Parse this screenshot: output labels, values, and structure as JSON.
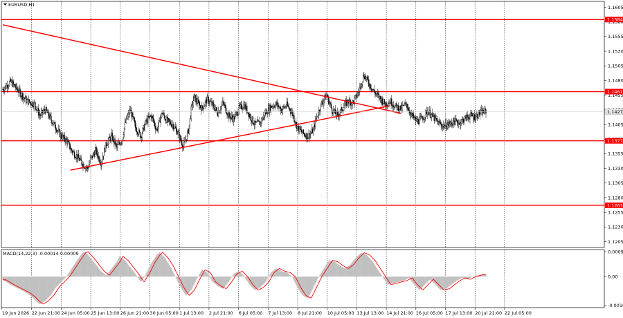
{
  "symbol_title": "EURUSD,H1",
  "colors": {
    "level": "#ff0000",
    "candle": "#000000",
    "macd_hist": "#c0c0c0",
    "signal": "#ff0000",
    "price_tag_bg": "#e6e6e6"
  },
  "chart_data": {
    "type": "candlestick",
    "price_axis": {
      "ticks": [
        "1.1605",
        "1.1580",
        "1.1555",
        "1.1530",
        "1.1505",
        "1.1480",
        "1.1455",
        "1.1430",
        "1.1405",
        "1.1380",
        "1.1355",
        "1.1330",
        "1.1305",
        "1.1280",
        "1.1255",
        "1.1230",
        "1.1205"
      ],
      "range": [
        1.1195,
        1.1615
      ]
    },
    "current_price": "1.1427",
    "horizontal_levels": [
      {
        "label": "1.1584",
        "value": 1.1584
      },
      {
        "label": "1.1461",
        "value": 1.1461
      },
      {
        "label": "1.1377",
        "value": 1.1377
      },
      {
        "label": "1.1267",
        "value": 1.1267
      }
    ],
    "trend_lines": [
      {
        "from": [
          "18 Jun 2026 21:00",
          1.1575
        ],
        "to": [
          "15 Jul 2026 13:00",
          1.1424
        ]
      },
      {
        "from": [
          "24 Jun 2026 05:00",
          1.1327
        ],
        "to": [
          "15 Jul 2026 00:00",
          1.1437
        ]
      }
    ],
    "time_labels": [
      "19 Jun 2026",
      "22 Jun 21:00",
      "24 Jun 05:00",
      "25 Jun 13:00",
      "26 Jun 21:00",
      "30 Jun 05:00",
      "1 Jul 13:00",
      "2 Jul 21:00",
      "6 Jul 05:00",
      "7 Jul 13:00",
      "8 Jul 21:00",
      "10 Jul 05:00",
      "13 Jul 13:00",
      "14 Jul 21:00",
      "16 Jul 05:00",
      "17 Jul 13:00",
      "20 Jul 21:00",
      "22 Jul 05:00"
    ],
    "price_path": [
      [
        0,
        1.1465
      ],
      [
        3,
        1.1478
      ],
      [
        6,
        1.1462
      ],
      [
        9,
        1.1445
      ],
      [
        12,
        1.144
      ],
      [
        14,
        1.142
      ],
      [
        16,
        1.143
      ],
      [
        18,
        1.1415
      ],
      [
        20,
        1.14
      ],
      [
        22,
        1.1385
      ],
      [
        24,
        1.1378
      ],
      [
        26,
        1.136
      ],
      [
        28,
        1.135
      ],
      [
        30,
        1.1338
      ],
      [
        32,
        1.133
      ],
      [
        33,
        1.1345
      ],
      [
        35,
        1.136
      ],
      [
        37,
        1.134
      ],
      [
        39,
        1.1372
      ],
      [
        41,
        1.1385
      ],
      [
        43,
        1.1365
      ],
      [
        45,
        1.138
      ],
      [
        46,
        1.1405
      ],
      [
        48,
        1.143
      ],
      [
        50,
        1.14
      ],
      [
        52,
        1.1385
      ],
      [
        54,
        1.141
      ],
      [
        56,
        1.142
      ],
      [
        58,
        1.1395
      ],
      [
        60,
        1.1425
      ],
      [
        62,
        1.141
      ],
      [
        64,
        1.1405
      ],
      [
        66,
        1.139
      ],
      [
        68,
        1.1368
      ],
      [
        69,
        1.138
      ],
      [
        70,
        1.1395
      ],
      [
        71,
        1.143
      ],
      [
        72,
        1.1452
      ],
      [
        73,
        1.1445
      ],
      [
        75,
        1.1432
      ],
      [
        77,
        1.1448
      ],
      [
        79,
        1.1438
      ],
      [
        81,
        1.1425
      ],
      [
        83,
        1.1442
      ],
      [
        85,
        1.142
      ],
      [
        87,
        1.1415
      ],
      [
        89,
        1.1432
      ],
      [
        91,
        1.1438
      ],
      [
        93,
        1.142
      ],
      [
        95,
        1.1405
      ],
      [
        97,
        1.1408
      ],
      [
        99,
        1.1425
      ],
      [
        101,
        1.1435
      ],
      [
        103,
        1.144
      ],
      [
        105,
        1.143
      ],
      [
        107,
        1.1438
      ],
      [
        109,
        1.1425
      ],
      [
        111,
        1.14
      ],
      [
        113,
        1.139
      ],
      [
        115,
        1.1385
      ],
      [
        117,
        1.1395
      ],
      [
        118,
        1.1415
      ],
      [
        120,
        1.144
      ],
      [
        122,
        1.1455
      ],
      [
        124,
        1.143
      ],
      [
        126,
        1.142
      ],
      [
        128,
        1.1432
      ],
      [
        130,
        1.1445
      ],
      [
        132,
        1.1442
      ],
      [
        134,
        1.146
      ],
      [
        136,
        1.149
      ],
      [
        138,
        1.1475
      ],
      [
        140,
        1.146
      ],
      [
        142,
        1.145
      ],
      [
        144,
        1.144
      ],
      [
        146,
        1.1445
      ],
      [
        148,
        1.1435
      ],
      [
        150,
        1.1432
      ],
      [
        152,
        1.144
      ],
      [
        154,
        1.142
      ],
      [
        156,
        1.141
      ],
      [
        158,
        1.1415
      ],
      [
        160,
        1.1428
      ],
      [
        162,
        1.1418
      ],
      [
        164,
        1.1408
      ],
      [
        166,
        1.1402
      ],
      [
        168,
        1.1405
      ],
      [
        170,
        1.141
      ],
      [
        172,
        1.1408
      ],
      [
        174,
        1.1415
      ],
      [
        176,
        1.142
      ],
      [
        178,
        1.1418
      ],
      [
        180,
        1.1425
      ],
      [
        182,
        1.1427
      ]
    ],
    "macd": {
      "label": "MACD(14,22,3) -0.00014 0.00009",
      "axis_ticks": [
        "0.00092",
        "0.00",
        "-0.00107"
      ],
      "range": [
        -0.00115,
        0.001
      ],
      "histogram": [
        [
          0,
          -0.00012
        ],
        [
          3,
          -0.0003
        ],
        [
          6,
          -0.00045
        ],
        [
          9,
          -0.0006
        ],
        [
          11,
          -0.00075
        ],
        [
          13,
          -0.00095
        ],
        [
          14,
          -0.00102
        ],
        [
          16,
          -0.0009
        ],
        [
          18,
          -0.0007
        ],
        [
          20,
          -0.0004
        ],
        [
          22,
          -0.0002
        ],
        [
          24,
          0.0
        ],
        [
          26,
          0.0003
        ],
        [
          28,
          0.0006
        ],
        [
          30,
          0.00088
        ],
        [
          31,
          0.00092
        ],
        [
          33,
          0.0007
        ],
        [
          35,
          0.00045
        ],
        [
          37,
          0.0002
        ],
        [
          39,
          5e-05
        ],
        [
          41,
          0.0003
        ],
        [
          43,
          0.00055
        ],
        [
          44,
          0.00075
        ],
        [
          46,
          0.0006
        ],
        [
          48,
          0.00035
        ],
        [
          50,
          0.0001
        ],
        [
          52,
          -0.0002
        ],
        [
          54,
          0.0001
        ],
        [
          56,
          0.0005
        ],
        [
          58,
          0.0008
        ],
        [
          59,
          0.0009
        ],
        [
          61,
          0.0007
        ],
        [
          63,
          0.0004
        ],
        [
          65,
          0.0
        ],
        [
          67,
          -0.0004
        ],
        [
          69,
          -0.0007
        ],
        [
          71,
          -0.0005
        ],
        [
          73,
          -0.0001
        ],
        [
          75,
          0.00025
        ],
        [
          77,
          0.00015
        ],
        [
          79,
          -0.0002
        ],
        [
          81,
          -0.00035
        ],
        [
          83,
          -0.00045
        ],
        [
          85,
          -0.0002
        ],
        [
          87,
          0.0001
        ],
        [
          89,
          0.0002
        ],
        [
          91,
          0.0
        ],
        [
          93,
          -0.0003
        ],
        [
          95,
          -0.0005
        ],
        [
          97,
          -0.0004
        ],
        [
          99,
          -0.0002
        ],
        [
          101,
          0.00015
        ],
        [
          103,
          0.0003
        ],
        [
          105,
          0.0002
        ],
        [
          107,
          0.00015
        ],
        [
          109,
          0.0
        ],
        [
          111,
          -0.0004
        ],
        [
          113,
          -0.0007
        ],
        [
          115,
          -0.0008
        ],
        [
          117,
          -0.0004
        ],
        [
          119,
          0.0
        ],
        [
          121,
          0.0003
        ],
        [
          123,
          0.0006
        ],
        [
          125,
          0.00055
        ],
        [
          127,
          0.0004
        ],
        [
          129,
          0.0003
        ],
        [
          131,
          0.00045
        ],
        [
          133,
          0.0007
        ],
        [
          135,
          0.00088
        ],
        [
          137,
          0.0008
        ],
        [
          139,
          0.0006
        ],
        [
          141,
          0.0003
        ],
        [
          143,
          0.0
        ],
        [
          145,
          -0.0003
        ],
        [
          147,
          -0.00025
        ],
        [
          149,
          -0.0002
        ],
        [
          151,
          -0.00015
        ],
        [
          153,
          -5e-05
        ],
        [
          155,
          -0.0003
        ],
        [
          157,
          -0.0005
        ],
        [
          159,
          -0.0003
        ],
        [
          161,
          -0.0001
        ],
        [
          163,
          -0.0003
        ],
        [
          165,
          -0.0005
        ],
        [
          167,
          -0.00045
        ],
        [
          169,
          -0.0003
        ],
        [
          171,
          -0.00015
        ],
        [
          173,
          -5e-05
        ],
        [
          175,
          -0.0001
        ],
        [
          177,
          0.0
        ],
        [
          179,
          5e-05
        ],
        [
          181,
          0.0001
        ],
        [
          182,
          9e-05
        ]
      ]
    }
  }
}
